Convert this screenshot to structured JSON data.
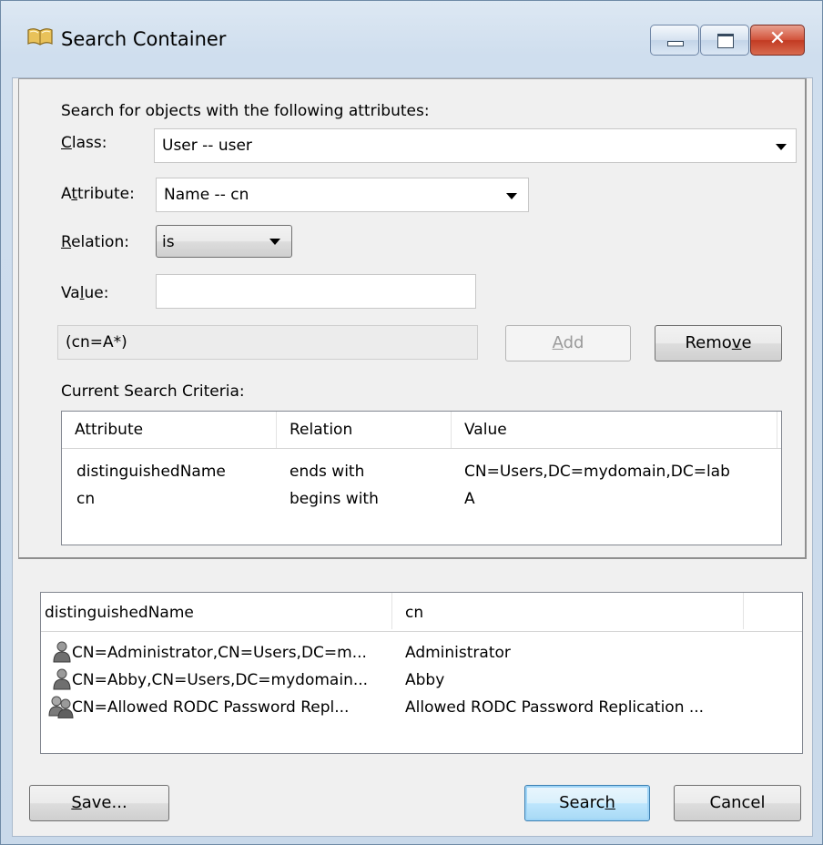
{
  "window": {
    "title": "Search Container",
    "close_glyph": "✕"
  },
  "criteria": {
    "intro": "Search for objects with the following attributes:",
    "class_label": "Class:",
    "class_value": "User  -- user",
    "attribute_label": "Attribute:",
    "attribute_value": "Name  -- cn",
    "relation_label": "Relation:",
    "relation_value": "is",
    "value_label": "Value:",
    "value_input": "",
    "filter_text": "(cn=A*)",
    "add_label": "Add",
    "remove_label": "Remove",
    "current_label": "Current Search Criteria:",
    "columns": [
      "Attribute",
      "Relation",
      "Value"
    ],
    "rows": [
      {
        "attribute": "distinguishedName",
        "relation": "ends with",
        "value": "CN=Users,DC=mydomain,DC=lab"
      },
      {
        "attribute": "cn",
        "relation": "begins with",
        "value": "A"
      }
    ]
  },
  "results": {
    "columns": [
      "distinguishedName",
      "cn"
    ],
    "rows": [
      {
        "dn": "CN=Administrator,CN=Users,DC=m...",
        "cn": "Administrator",
        "icon": "user-icon"
      },
      {
        "dn": "CN=Abby,CN=Users,DC=mydomain...",
        "cn": "Abby",
        "icon": "user-icon"
      },
      {
        "dn": "CN=Allowed RODC Password Repl...",
        "cn": "Allowed RODC Password Replication ...",
        "icon": "group-icon"
      }
    ]
  },
  "footer": {
    "save_label": "Save...",
    "search_label": "Search",
    "cancel_label": "Cancel"
  }
}
